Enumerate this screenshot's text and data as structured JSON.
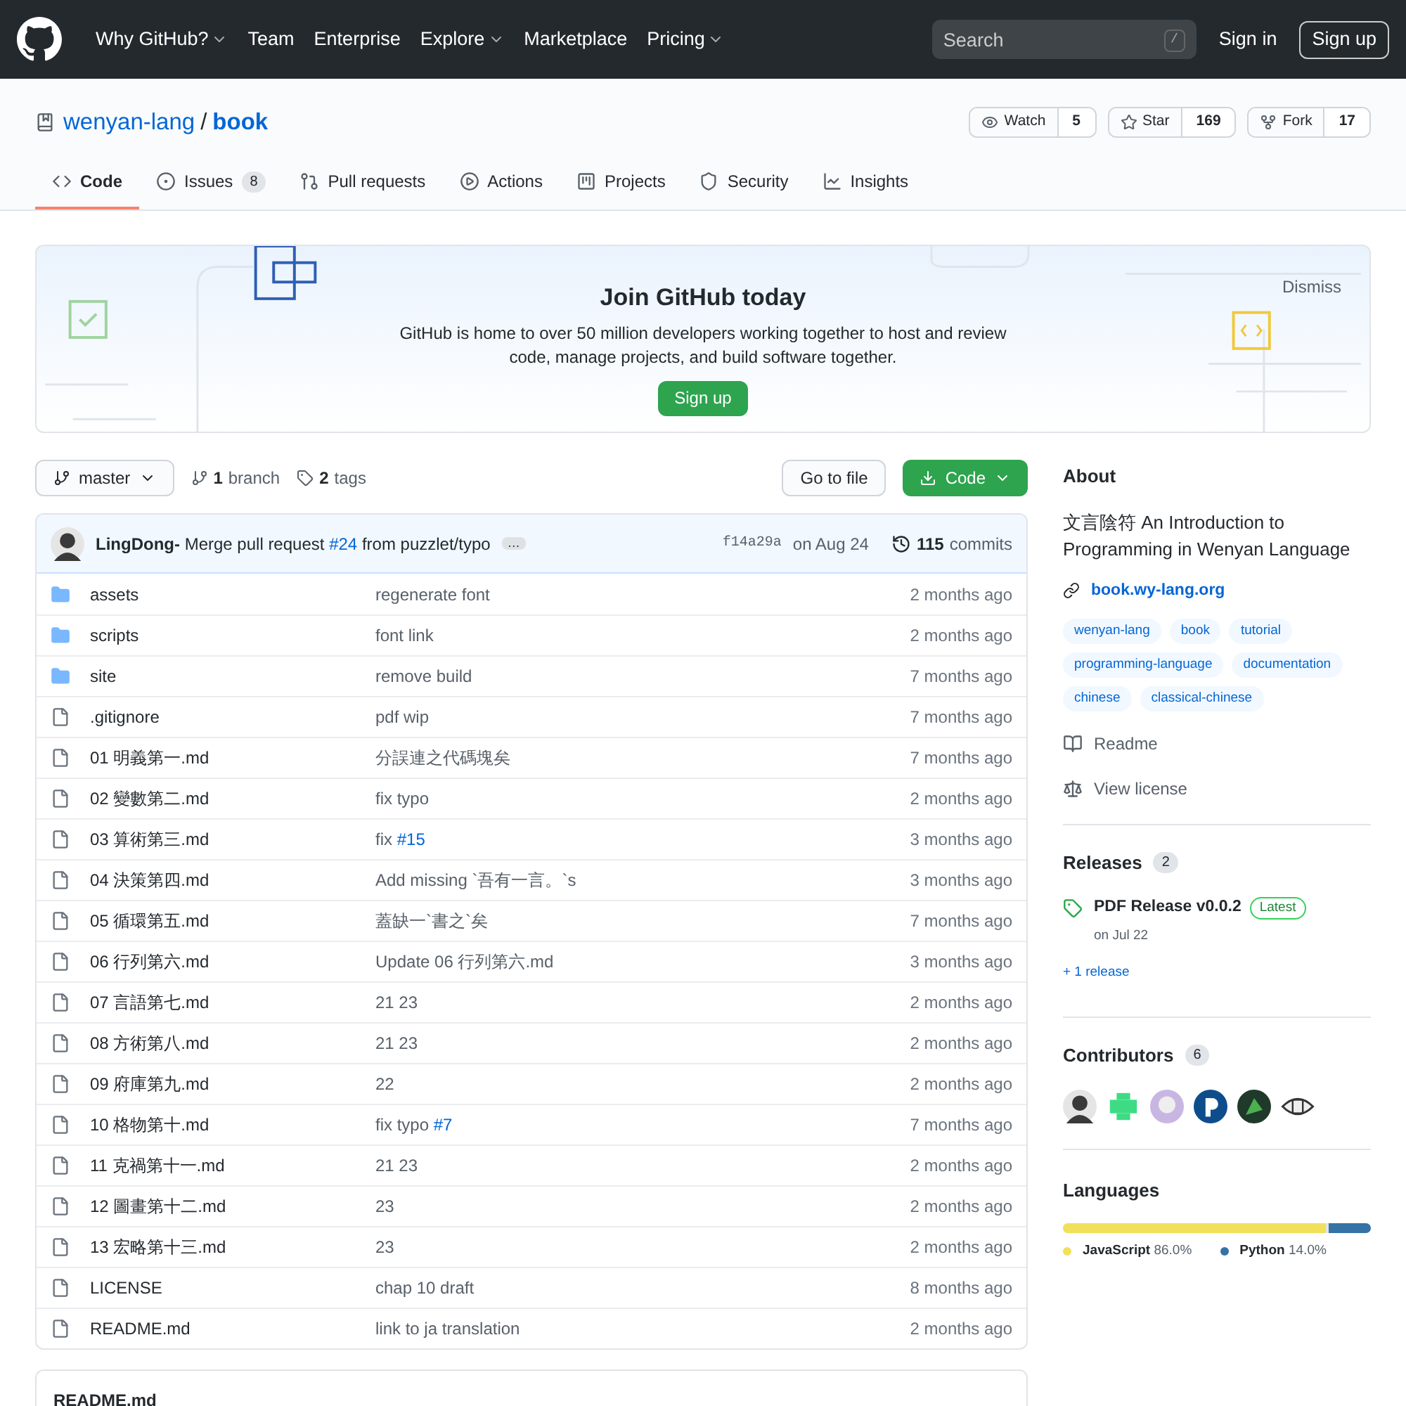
{
  "header": {
    "nav": [
      {
        "label": "Why GitHub?",
        "caret": true
      },
      {
        "label": "Team",
        "caret": false
      },
      {
        "label": "Enterprise",
        "caret": false
      },
      {
        "label": "Explore",
        "caret": true
      },
      {
        "label": "Marketplace",
        "caret": false
      },
      {
        "label": "Pricing",
        "caret": true
      }
    ],
    "search": {
      "placeholder": "Search",
      "key": "/"
    },
    "sign_in": "Sign in",
    "sign_up": "Sign up"
  },
  "repo": {
    "owner": "wenyan-lang",
    "separator": "/",
    "name": "book",
    "actions": [
      {
        "kind": "watch",
        "label": "Watch",
        "count": "5"
      },
      {
        "kind": "star",
        "label": "Star",
        "count": "169"
      },
      {
        "kind": "fork",
        "label": "Fork",
        "count": "17"
      }
    ]
  },
  "tabs": [
    {
      "kind": "code",
      "label": "Code",
      "selected": true
    },
    {
      "kind": "issues",
      "label": "Issues",
      "count": "8",
      "selected": false
    },
    {
      "kind": "pulls",
      "label": "Pull requests",
      "selected": false
    },
    {
      "kind": "actions",
      "label": "Actions",
      "selected": false
    },
    {
      "kind": "projects",
      "label": "Projects",
      "selected": false
    },
    {
      "kind": "security",
      "label": "Security",
      "selected": false
    },
    {
      "kind": "insights",
      "label": "Insights",
      "selected": false
    }
  ],
  "banner": {
    "title": "Join GitHub today",
    "text": "GitHub is home to over 50 million developers working together to host and review code, manage projects, and build software together.",
    "button": "Sign up",
    "dismiss": "Dismiss"
  },
  "branch_bar": {
    "branch": "master",
    "branch_count": "1",
    "branch_label": "branch",
    "tag_count": "2",
    "tag_label": "tags",
    "go_to_file": "Go to file",
    "code_button": "Code"
  },
  "commit": {
    "author": "LingDong-",
    "message": "Merge pull request",
    "link": "#24",
    "message_end": "from puzzlet/typo",
    "ellipsis": "…",
    "sha": "f14a29a",
    "date": "on Aug 24",
    "count": "115",
    "count_label": "commits"
  },
  "files": [
    {
      "kind": "folder",
      "name": "assets",
      "message": "regenerate font",
      "time": "2 months ago"
    },
    {
      "kind": "folder",
      "name": "scripts",
      "message": "font link",
      "time": "2 months ago"
    },
    {
      "kind": "folder",
      "name": "site",
      "message": "remove build",
      "time": "7 months ago"
    },
    {
      "kind": "file",
      "name": ".gitignore",
      "message": "pdf wip",
      "time": "7 months ago"
    },
    {
      "kind": "file",
      "name": "01 明義第一.md",
      "message": "分誤連之代碼塊矣",
      "time": "7 months ago"
    },
    {
      "kind": "file",
      "name": "02 變數第二.md",
      "message": "fix typo",
      "time": "2 months ago"
    },
    {
      "kind": "file",
      "name": "03 算術第三.md",
      "message": "fix",
      "link": "#15",
      "time": "3 months ago"
    },
    {
      "kind": "file",
      "name": "04 決策第四.md",
      "message": "Add missing `吾有一言。`s",
      "time": "3 months ago"
    },
    {
      "kind": "file",
      "name": "05 循環第五.md",
      "message": "蓋缺一`書之`矣",
      "time": "7 months ago"
    },
    {
      "kind": "file",
      "name": "06 行列第六.md",
      "message": "Update 06 行列第六.md",
      "time": "3 months ago"
    },
    {
      "kind": "file",
      "name": "07 言語第七.md",
      "message": "21 23",
      "time": "2 months ago"
    },
    {
      "kind": "file",
      "name": "08 方術第八.md",
      "message": "21 23",
      "time": "2 months ago"
    },
    {
      "kind": "file",
      "name": "09 府庫第九.md",
      "message": "22",
      "time": "2 months ago"
    },
    {
      "kind": "file",
      "name": "10 格物第十.md",
      "message": "fix typo",
      "link": "#7",
      "time": "7 months ago"
    },
    {
      "kind": "file",
      "name": "11 克禍第十一.md",
      "message": "21 23",
      "time": "2 months ago"
    },
    {
      "kind": "file",
      "name": "12 圖畫第十二.md",
      "message": "23",
      "time": "2 months ago"
    },
    {
      "kind": "file",
      "name": "13 宏略第十三.md",
      "message": "23",
      "time": "2 months ago"
    },
    {
      "kind": "file",
      "name": "LICENSE",
      "message": "chap 10 draft",
      "time": "8 months ago"
    },
    {
      "kind": "file",
      "name": "README.md",
      "message": "link to ja translation",
      "time": "2 months ago"
    }
  ],
  "readme": {
    "title": "README.md"
  },
  "about": {
    "title": "About",
    "description": "文言陰符 An Introduction to Programming in Wenyan Language",
    "website": "book.wy-lang.org",
    "topics": [
      "wenyan-lang",
      "book",
      "tutorial",
      "programming-language",
      "documentation",
      "chinese",
      "classical-chinese"
    ],
    "readme": "Readme",
    "license": "View license"
  },
  "releases": {
    "title": "Releases",
    "count": "2",
    "name": "PDF Release v0.0.2",
    "badge": "Latest",
    "date": "on Jul 22",
    "more": "+ 1 release"
  },
  "contributors": {
    "title": "Contributors",
    "count": "6",
    "avatars": [
      {
        "color": "#3a3a3a"
      },
      {
        "color": "#3ddc84"
      },
      {
        "color": "#c8b6e2"
      },
      {
        "color": "#0d4d8c"
      },
      {
        "color": "#1f3a2a"
      },
      {
        "color": "#eeeeee"
      }
    ]
  },
  "languages": {
    "title": "Languages",
    "items": [
      {
        "name": "JavaScript",
        "percent": "86.0%",
        "color": "#f1e05a",
        "level": 0.86
      },
      {
        "name": "Python",
        "percent": "14.0%",
        "color": "#3572a5",
        "level": 0.14
      }
    ]
  }
}
